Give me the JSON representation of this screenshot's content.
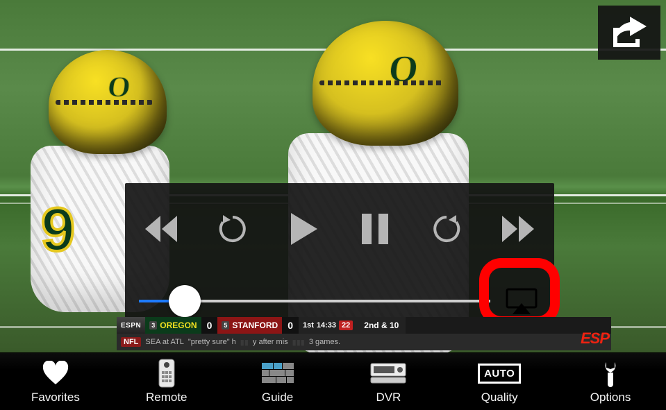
{
  "share": {
    "icon": "share-icon"
  },
  "player": {
    "progress_percent": 13,
    "buttons": {
      "rewind": "rewind-icon",
      "skip_back": "skip-back-icon",
      "play": "play-icon",
      "pause": "pause-icon",
      "skip_forward": "skip-forward-icon",
      "fast_forward": "fast-forward-icon",
      "airplay": "airplay-icon"
    }
  },
  "score_bug": {
    "network": "ESPN",
    "away": {
      "rank": "3",
      "name": "OREGON",
      "score": "0"
    },
    "home": {
      "rank": "5",
      "name": "STANFORD",
      "score": "0"
    },
    "quarter": "1st",
    "clock": "14:33",
    "play_clock": "22",
    "down_distance": "2nd & 10",
    "ticker_prefix": "SEA at ATL",
    "ticker_quote": "\"pretty sure\" h",
    "ticker_mid": "y after mis",
    "ticker_end": "3 games.",
    "watermark": "ESP",
    "nfl_badge": "NFL"
  },
  "nav": {
    "items": [
      {
        "key": "favorites",
        "label": "Favorites",
        "icon": "heart-icon"
      },
      {
        "key": "remote",
        "label": "Remote",
        "icon": "remote-icon"
      },
      {
        "key": "guide",
        "label": "Guide",
        "icon": "guide-grid-icon"
      },
      {
        "key": "dvr",
        "label": "DVR",
        "icon": "dvr-icon"
      },
      {
        "key": "quality",
        "label": "Quality",
        "icon": "auto-badge-icon",
        "badge_text": "AUTO"
      },
      {
        "key": "options",
        "label": "Options",
        "icon": "wrench-icon"
      }
    ]
  }
}
